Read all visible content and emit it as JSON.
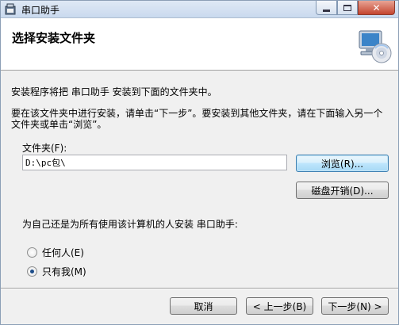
{
  "window": {
    "title": "串口助手",
    "minimize_icon": "minimize-icon",
    "maximize_icon": "maximize-icon",
    "close_icon": "close-icon",
    "close_glyph": "✕"
  },
  "banner": {
    "title": "选择安装文件夹",
    "icon": "computer-cd-icon"
  },
  "body": {
    "intro": "安装程序将把 串口助手 安装到下面的文件夹中。",
    "instructions": "要在该文件夹中进行安装，请单击“下一步”。要安装到其他文件夹，请在下面输入另一个文件夹或单击“浏览”。",
    "folder_label": "文件夹(F):",
    "folder_value": "D:\\pc包\\",
    "browse_button": "浏览(R)...",
    "disk_cost_button": "磁盘开销(D)...",
    "install_for_label": "为自己还是为所有使用该计算机的人安装 串口助手:",
    "radio_everyone": "任何人(E)",
    "radio_just_me": "只有我(M)",
    "selected_option": "只有我(M)"
  },
  "footer": {
    "cancel_button": "取消",
    "back_button": "< 上一步(B)",
    "next_button": "下一步(N) >"
  }
}
